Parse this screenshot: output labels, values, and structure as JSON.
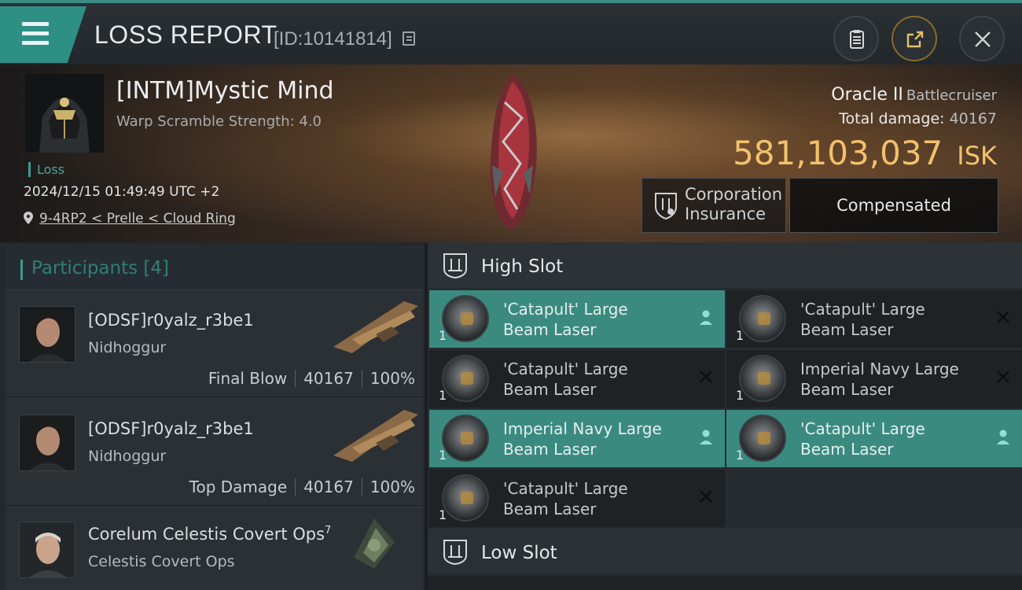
{
  "header": {
    "title": "LOSS REPORT",
    "report_id": "[ID:10141814]",
    "buttons": [
      "clipboard-icon",
      "share-icon",
      "close-icon"
    ]
  },
  "victim": {
    "name": "[INTM]Mystic Mind",
    "warp_scramble": "Warp Scramble Strength: 4.0",
    "tag": "Loss",
    "datetime": "2024/12/15 01:49:49 UTC +2",
    "location": "9-4RP2 < Prelle < Cloud Ring"
  },
  "ship": {
    "name": "Oracle II",
    "class": "Battlecruiser",
    "damage_label": "Total damage:",
    "damage_value": "40167",
    "isk_value": "581,103,037",
    "isk_unit": "ISK",
    "insurance_line1": "Corporation",
    "insurance_line2": "Insurance",
    "compensation": "Compensated"
  },
  "participants": {
    "title": "Participants [4]",
    "rows": [
      {
        "name": "[ODSF]r0yalz_r3be1",
        "ship": "Nidhoggur",
        "role": "Final Blow",
        "damage": "40167",
        "percent": "100%"
      },
      {
        "name": "[ODSF]r0yalz_r3be1",
        "ship": "Nidhoggur",
        "role": "Top Damage",
        "damage": "40167",
        "percent": "100%"
      },
      {
        "name": "Corelum Celestis Covert Ops",
        "sup": "7",
        "ship": "Celestis Covert Ops"
      }
    ]
  },
  "slots": {
    "high_title": "High Slot",
    "low_title": "Low Slot",
    "high": [
      {
        "line1": "'Catapult' Large",
        "line2": "Beam Laser",
        "qty": "1",
        "status": "active"
      },
      {
        "line1": "'Catapult' Large",
        "line2": "Beam Laser",
        "qty": "1",
        "status": "destroyed"
      },
      {
        "line1": "'Catapult' Large",
        "line2": "Beam Laser",
        "qty": "1",
        "status": "destroyed"
      },
      {
        "line1": "Imperial Navy Large",
        "line2": "Beam Laser",
        "qty": "1",
        "status": "destroyed"
      },
      {
        "line1": "Imperial Navy Large",
        "line2": "Beam Laser",
        "qty": "1",
        "status": "active"
      },
      {
        "line1": "'Catapult' Large",
        "line2": "Beam Laser",
        "qty": "1",
        "status": "active"
      },
      {
        "line1": "'Catapult' Large",
        "line2": "Beam Laser",
        "qty": "1",
        "status": "destroyed"
      }
    ]
  },
  "colors": {
    "accent": "#3b8a80",
    "isk": "#f1c26b",
    "background": "#1b1e22"
  }
}
